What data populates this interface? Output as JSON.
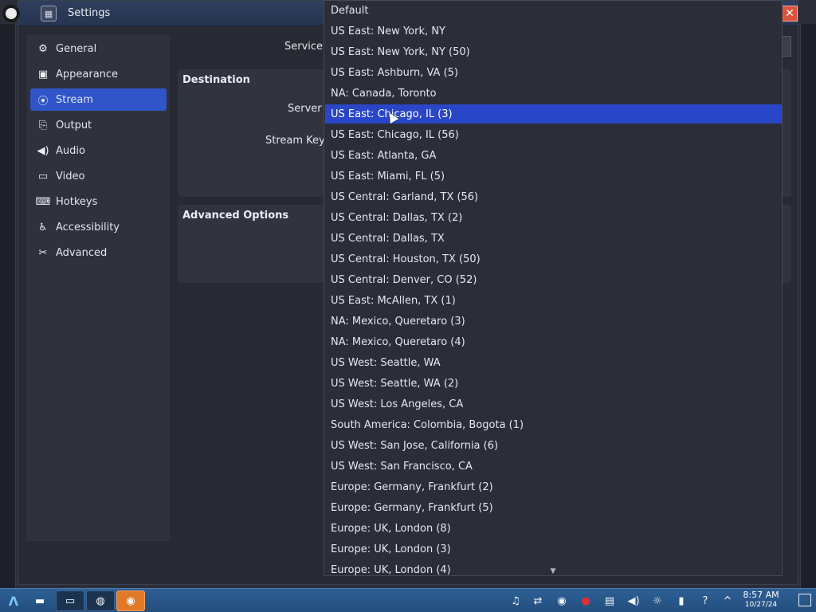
{
  "window": {
    "title": "Settings",
    "close_symbol": "✕"
  },
  "sidebar": {
    "items": [
      {
        "label": "General",
        "icon": "gear-icon"
      },
      {
        "label": "Appearance",
        "icon": "appearance-icon"
      },
      {
        "label": "Stream",
        "icon": "antenna-icon"
      },
      {
        "label": "Output",
        "icon": "output-icon"
      },
      {
        "label": "Audio",
        "icon": "speaker-icon"
      },
      {
        "label": "Video",
        "icon": "monitor-icon"
      },
      {
        "label": "Hotkeys",
        "icon": "keyboard-icon"
      },
      {
        "label": "Accessibility",
        "icon": "accessibility-icon"
      },
      {
        "label": "Advanced",
        "icon": "tools-icon"
      }
    ],
    "active": "Stream"
  },
  "content": {
    "service_label": "Service",
    "destination_title": "Destination",
    "server_label": "Server",
    "stream_key_label": "Stream Key",
    "advanced_title": "Advanced Options"
  },
  "dropdown": {
    "selected": "US East: Chicago, IL (3)",
    "options": [
      "Default",
      "US East: New York, NY",
      "US East: New York, NY (50)",
      "US East: Ashburn, VA (5)",
      "NA: Canada, Toronto",
      "US East: Chicago, IL (3)",
      "US East: Chicago, IL (56)",
      "US East: Atlanta, GA",
      "US East: Miami, FL (5)",
      "US Central: Garland, TX (56)",
      "US Central: Dallas, TX (2)",
      "US Central: Dallas, TX",
      "US Central: Houston, TX (50)",
      "US Central: Denver, CO (52)",
      "US East: McAllen, TX (1)",
      "NA: Mexico, Queretaro (3)",
      "NA: Mexico, Queretaro (4)",
      "US West: Seattle, WA",
      "US West: Seattle, WA (2)",
      "US West: Los Angeles, CA",
      "South America: Colombia, Bogota (1)",
      "US West: San Jose, California (6)",
      "US West: San Francisco, CA",
      "Europe: Germany, Frankfurt (2)",
      "Europe: Germany, Frankfurt (5)",
      "Europe: UK, London (8)",
      "Europe: UK, London (3)",
      "Europe: UK, London (4)"
    ]
  },
  "taskbar": {
    "time": "8:57 AM",
    "date": "10/27/24"
  },
  "colors": {
    "accent": "#2f55c8",
    "selected_option": "#2a46c8",
    "taskbar": "#2d5f94",
    "close_button": "#d9533d"
  }
}
